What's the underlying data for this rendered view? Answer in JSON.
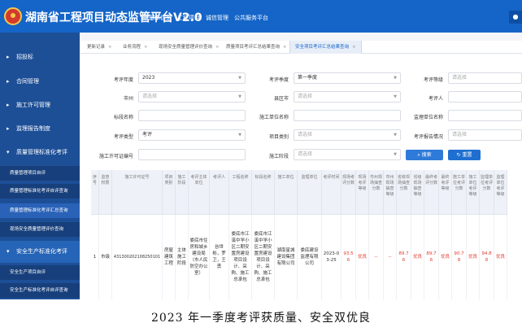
{
  "app": {
    "title": "湖南省工程项目动态监管平台V2.0",
    "nav": [
      "基本信息",
      "工程项目",
      "诚信管理",
      "公共服务平台"
    ],
    "user_icon": "user-icon"
  },
  "sidebar": {
    "items": [
      {
        "label": "招投标",
        "level": 1
      },
      {
        "label": "合同管理",
        "level": 1
      },
      {
        "label": "施工许可管理",
        "level": 1
      },
      {
        "label": "监理报告制度",
        "level": 1
      },
      {
        "label": "质量管理标准化考评",
        "level": 1
      },
      {
        "label": "质量管理项目自评",
        "level": 2
      },
      {
        "label": "质量管理标准化考评自评查询",
        "level": 2
      },
      {
        "label": "质量管理标准化考评汇总查询",
        "level": 2
      },
      {
        "label": "现场安全质量管理评价查询",
        "level": 2
      },
      {
        "label": "安全生产标准化考评",
        "level": 1
      },
      {
        "label": "安全生产项目自评",
        "level": 2
      },
      {
        "label": "安全生产标准化考评自评查询",
        "level": 2
      }
    ]
  },
  "tabs": [
    {
      "label": "更新记录"
    },
    {
      "label": "业务流程"
    },
    {
      "label": "现场安全质量管理评价查询"
    },
    {
      "label": "质量项目考评汇总结果查询"
    },
    {
      "label": "安全项目考评汇总结果查询"
    }
  ],
  "filters": {
    "year_label": "考评年度",
    "year_value": "2023",
    "quarter_label": "考评季度",
    "quarter_value": "第一季度",
    "grade_label": "考评等级",
    "grade_placeholder": "请选择",
    "city_label": "市州",
    "city_placeholder": "请选择",
    "district_label": "县区市",
    "district_placeholder": "请选择",
    "assessor_label": "考评人",
    "project_name_label": "标段名称",
    "builder_label": "施工单位名称",
    "supervisor_label": "监理单位名称",
    "type_label": "考评类型",
    "type_value": "考评",
    "category_label": "项目类别",
    "category_placeholder": "请选择",
    "report_label": "考评报告情况",
    "report_placeholder": "请选择",
    "permit_label": "施工许可证编号",
    "stage_label": "施工阶段",
    "stage_placeholder": "请选择",
    "search_label": "搜索",
    "reset_label": "重置"
  },
  "table": {
    "headers": [
      "序号",
      "监管权限",
      "施工许可证号",
      "项目类别",
      "施工阶段",
      "考评主体单位",
      "考评人",
      "工程名称",
      "标段名称",
      "施工单位",
      "监理单位",
      "考评时间",
      "现场考评分数",
      "现场考评等级",
      "市州现场抽查分数",
      "市州现场抽查等级",
      "省级现场抽查分数",
      "省级现场抽查等级",
      "最终考评分数",
      "最终考评等级",
      "施工单位考评分数",
      "施工单位考评等级",
      "监理单位考评分数",
      "监理单位考评等级"
    ],
    "row": [
      "1",
      "市级",
      "43130020210825010​1",
      "房屋建筑工程",
      "主体施工阶段",
      "娄底市住房和城乡建设局（市人民防空办公室）",
      "谷世彬，罗卫，王勇",
      "娄底市江溪中学小区二期安置房建设项目设计、采购、施工总承包",
      "娄底市江溪中学小区二期安置房建设项目设计、采购、施工总承包",
      "湖南星城建设集团有限公司",
      "娄底建设监理有限公司",
      "2023-03-25",
      "93.56",
      "优良",
      "--",
      "--",
      "89.76",
      "优良",
      "89.76",
      "优良",
      "90.78",
      "优良",
      "94.88",
      "优良"
    ]
  },
  "caption": "2023 年一季度考评获质量、安全双优良"
}
